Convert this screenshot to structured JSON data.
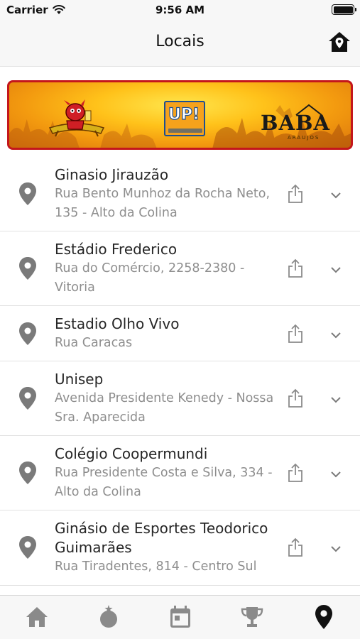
{
  "status_bar": {
    "carrier": "Carrier",
    "time": "9:56 AM"
  },
  "nav": {
    "title": "Locais",
    "right_icon": "home-pin-icon"
  },
  "banner": {
    "logos": [
      "bar-mascot-logo",
      "UP!",
      "BABA"
    ],
    "up_text": "UP!",
    "baba_text": "BABA",
    "baba_subtext": "ARAUJOS"
  },
  "locations": [
    {
      "name": "Ginasio Jirauzão",
      "address": "Rua Bento Munhoz da Rocha Neto, 135 - Alto da Colina"
    },
    {
      "name": "Estádio Frederico",
      "address": "Rua do Comércio, 2258-2380 - Vitoria"
    },
    {
      "name": "Estadio Olho Vivo",
      "address": "Rua Caracas"
    },
    {
      "name": "Unisep",
      "address": "Avenida Presidente Kenedy - Nossa Sra. Aparecida"
    },
    {
      "name": "Colégio Coopermundi",
      "address": "Rua Presidente Costa e Silva, 334 - Alto da Colina"
    },
    {
      "name": "Ginásio de Esportes Teodorico Guimarães",
      "address": "Rua Tiradentes, 814 - Centro Sul"
    }
  ],
  "tabs": [
    {
      "icon": "home-icon",
      "active": false
    },
    {
      "icon": "ball-icon",
      "active": false
    },
    {
      "icon": "calendar-icon",
      "active": false
    },
    {
      "icon": "trophy-icon",
      "active": false
    },
    {
      "icon": "location-pin-icon",
      "active": true
    }
  ],
  "colors": {
    "active_tab": "#111111",
    "inactive_tab": "#8a8a8a",
    "pin": "#7a7a7a",
    "banner_border": "#c4161c",
    "banner_fill": "#ffc21a"
  }
}
